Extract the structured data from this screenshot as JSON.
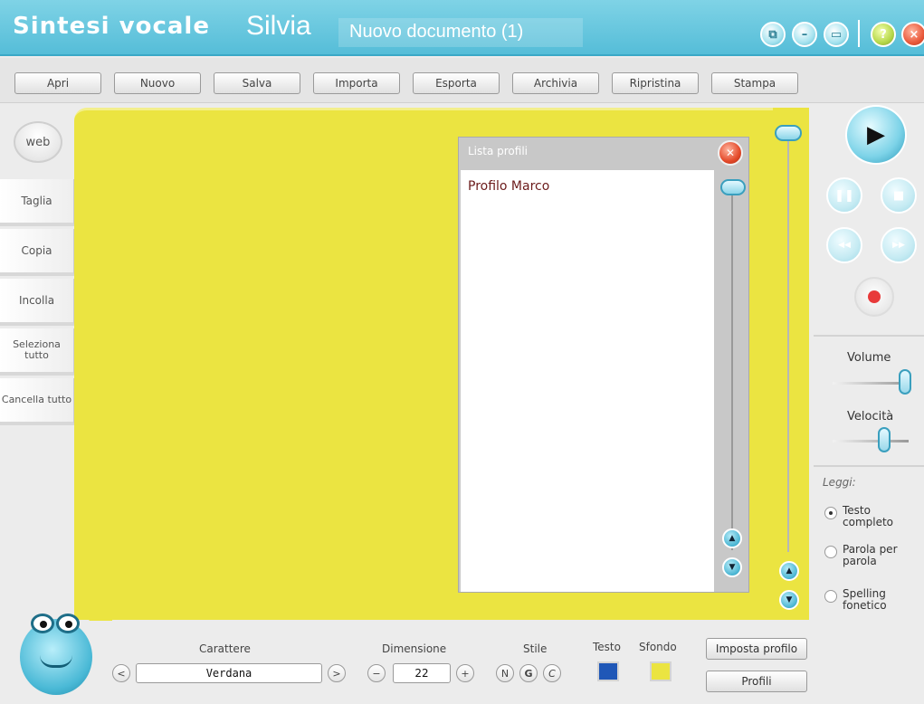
{
  "window": {
    "app_title_bold": "Sintesi vocale",
    "app_title_light": "Silvia",
    "document_title": "Nuovo documento (1)",
    "controls": {
      "restore": "⧉",
      "minimize": "–",
      "maximize": "▭",
      "help": "?",
      "close": "×"
    }
  },
  "toolbar": {
    "open": "Apri",
    "new": "Nuovo",
    "save": "Salva",
    "import": "Importa",
    "export": "Esporta",
    "archive": "Archivia",
    "restore": "Ripristina",
    "print": "Stampa"
  },
  "sidebar": {
    "web": "web",
    "cut": "Taglia",
    "copy": "Copia",
    "paste": "Incolla",
    "select_all": "Seleziona tutto",
    "clear_all": "Cancella tutto"
  },
  "profile_popup": {
    "title": "Lista profili",
    "items": [
      "Profilo Marco"
    ]
  },
  "playback": {
    "play": "▶",
    "pause": "❚❚",
    "stop": "■",
    "rewind": "◀◀",
    "forward": "▶▶"
  },
  "audio": {
    "volume_label": "Volume",
    "speed_label": "Velocità",
    "volume_level": 0.95,
    "speed_level": 0.68
  },
  "read_mode": {
    "label": "Leggi:",
    "options": [
      "Testo completo",
      "Parola per parola",
      "Spelling fonetico"
    ],
    "selected": "Testo completo"
  },
  "format": {
    "font_label": "Carattere",
    "font_value": "Verdana",
    "prev": "<",
    "next": ">",
    "size_label": "Dimensione",
    "size_value": "22",
    "decrease": "−",
    "increase": "+",
    "style_label": "Stile",
    "style_normal": "N",
    "style_bold": "G",
    "style_italic": "C",
    "text_color_label": "Testo",
    "background_color_label": "Sfondo",
    "text_color": "#1f57b7",
    "background_color": "#ebe441",
    "set_profile": "Imposta profilo",
    "profiles": "Profili"
  }
}
